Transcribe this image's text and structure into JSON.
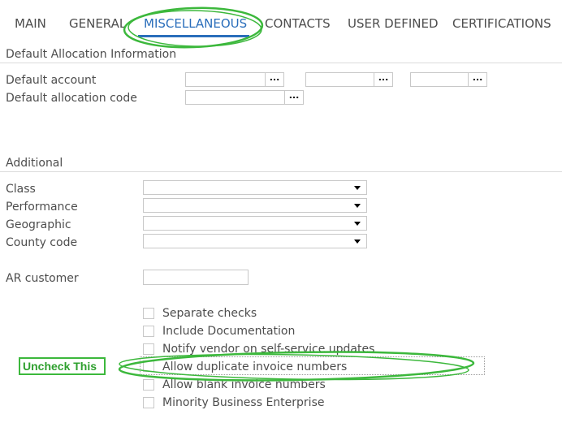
{
  "tabs": [
    {
      "label": "MAIN"
    },
    {
      "label": "GENERAL"
    },
    {
      "label": "MISCELLANEOUS"
    },
    {
      "label": "CONTACTS"
    },
    {
      "label": "USER DEFINED"
    },
    {
      "label": "CERTIFICATIONS"
    }
  ],
  "active_tab": "MISCELLANEOUS",
  "default_allocation": {
    "title": "Default Allocation Information",
    "account_label": "Default account",
    "allocation_code_label": "Default allocation code",
    "lookup_button_label": "..."
  },
  "additional": {
    "title": "Additional",
    "class_label": "Class",
    "performance_label": "Performance",
    "geographic_label": "Geographic",
    "county_code_label": "County code",
    "ar_customer_label": "AR customer"
  },
  "checkboxes": [
    {
      "label": "Separate checks",
      "checked": false
    },
    {
      "label": "Include Documentation",
      "checked": false
    },
    {
      "label": "Notify vendor on self-service updates",
      "checked": false
    },
    {
      "label": "Allow duplicate invoice numbers",
      "checked": false
    },
    {
      "label": "Allow blank invoice numbers",
      "checked": false
    },
    {
      "label": "Minority Business Enterprise",
      "checked": false
    }
  ],
  "annotation": {
    "callout_text": "Uncheck This",
    "highlight_color": "#3cb83c"
  },
  "colors": {
    "accent": "#2a6ebb",
    "text": "#4d4d4d",
    "border": "#c8c8c8"
  }
}
